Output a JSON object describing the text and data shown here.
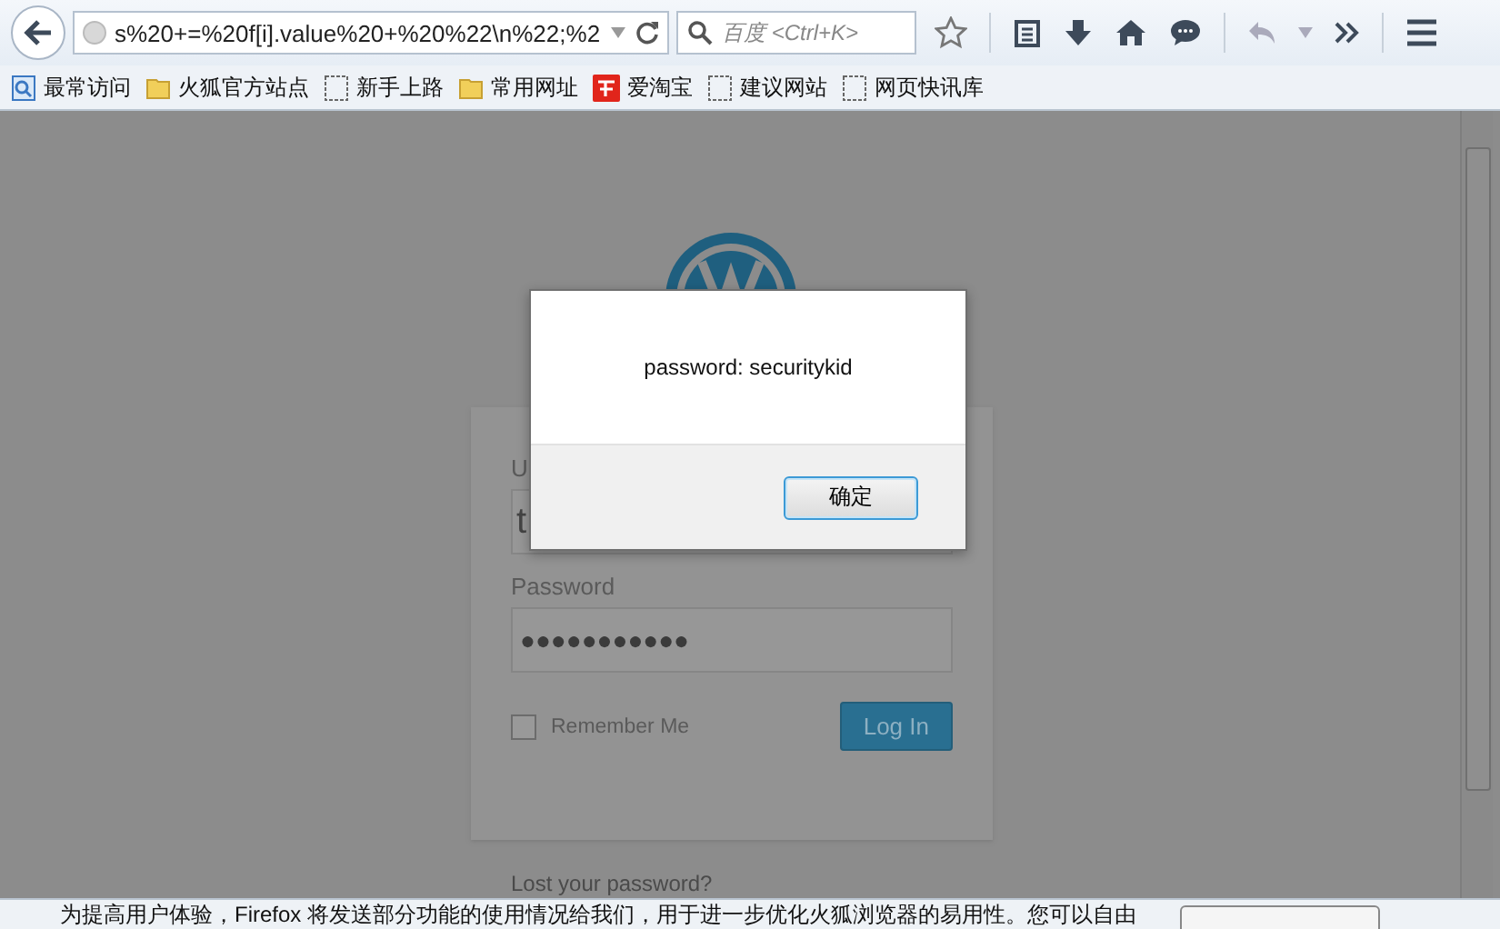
{
  "browser": {
    "url": "s%20+=%20f[i].value%20+%20%22\\n%22;%2",
    "search_placeholder": "百度 <Ctrl+K>"
  },
  "bookmarks": [
    {
      "label": "最常访问",
      "kind": "special"
    },
    {
      "label": "火狐官方站点",
      "kind": "folder"
    },
    {
      "label": "新手上路",
      "kind": "page"
    },
    {
      "label": "常用网址",
      "kind": "folder"
    },
    {
      "label": "爱淘宝",
      "kind": "taobao"
    },
    {
      "label": "建议网站",
      "kind": "page"
    },
    {
      "label": "网页快讯库",
      "kind": "page"
    }
  ],
  "login": {
    "username_label": "U",
    "username_value": "t",
    "password_label": "Password",
    "password_value": "●●●●●●●●●●●",
    "remember_label": "Remember Me",
    "remember_checked": false,
    "login_button": "Log In",
    "lost_password": "Lost your password?"
  },
  "dialog": {
    "message": "password: securitykid",
    "ok_button": "确定"
  },
  "notification": {
    "text": "为提高用户体验，Firefox 将发送部分功能的使用情况给我们，用于进一步优化火狐浏览器的易用性。您可以自由"
  }
}
